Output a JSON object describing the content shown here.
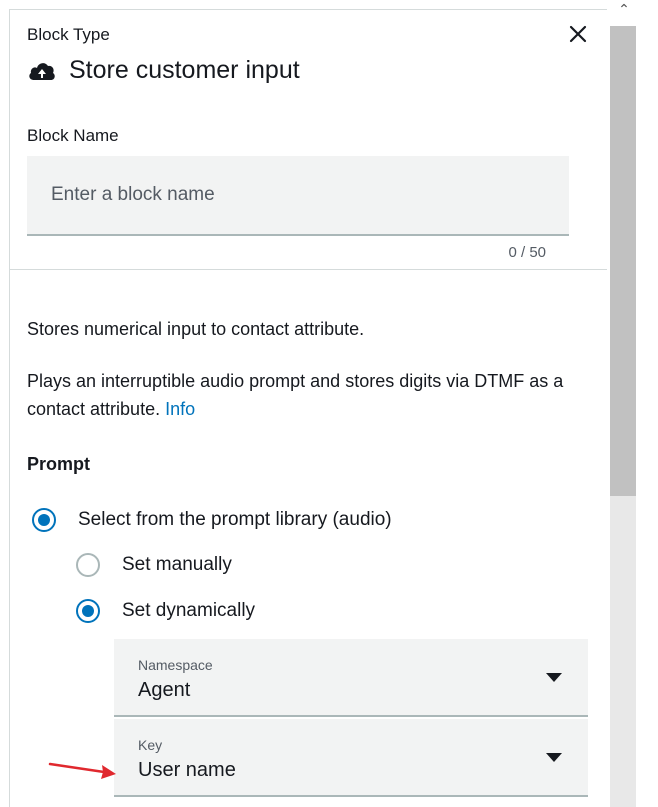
{
  "header": {
    "block_type_label": "Block Type",
    "title": "Store customer input",
    "title_icon": "cloud-icon",
    "close_icon": "close-icon"
  },
  "block_name": {
    "label": "Block Name",
    "value": "",
    "placeholder": "Enter a block name",
    "char_count": "0 / 50"
  },
  "description": {
    "line1": "Stores numerical input to contact attribute.",
    "line2": "Plays an interruptible audio prompt and stores digits via DTMF as a contact attribute.",
    "info_link": "Info"
  },
  "prompt": {
    "heading": "Prompt",
    "options": [
      {
        "label": "Select from the prompt library (audio)",
        "checked": true
      },
      {
        "label": "Set manually",
        "checked": false
      },
      {
        "label": "Set dynamically",
        "checked": true
      }
    ],
    "namespace": {
      "label": "Namespace",
      "value": "Agent"
    },
    "key": {
      "label": "Key",
      "value": "User name"
    }
  },
  "colors": {
    "accent": "#0073bb",
    "field_bg": "#f2f3f3",
    "annotation_arrow": "#e0282e"
  }
}
